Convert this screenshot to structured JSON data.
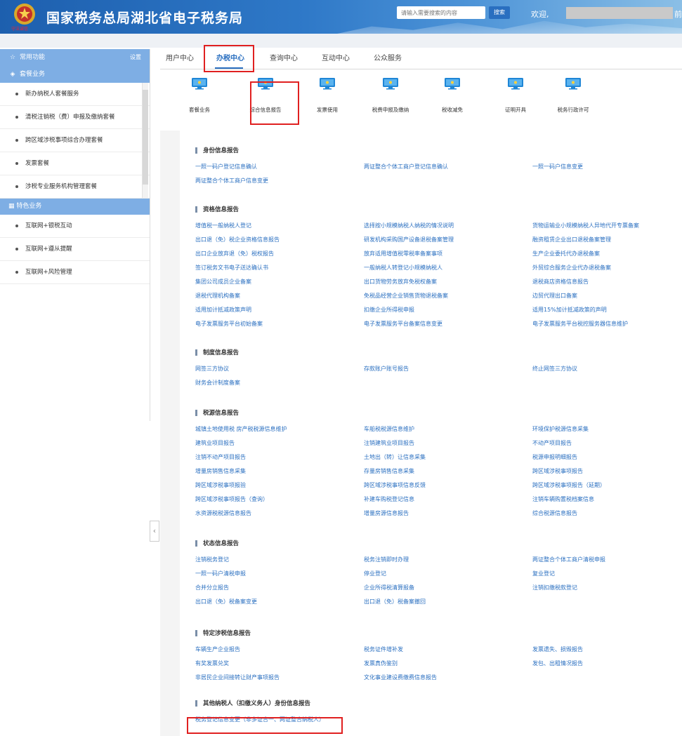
{
  "header": {
    "logo_sub": "守法诚信",
    "title": "国家税务总局湖北省电子税务局",
    "search_placeholder": "请输入需要搜索的内容",
    "search_label": "搜索",
    "welcome": "欢迎,",
    "welcome_tail": "前",
    "logo_color": "#e02020"
  },
  "sidebar": {
    "common": "常用功能",
    "settings": "设置",
    "package": "套餐业务",
    "package_items": [
      "新办纳税人套餐服务",
      "清税注销税（费）申报及缴纳套餐",
      "跨区域涉税事项综合办理套餐",
      "发票套餐",
      "涉税专业服务机构管理套餐"
    ],
    "special": "特色业务",
    "special_items": [
      "互联网+银税互动",
      "互联网+遵从提醒",
      "互联网+风险管理"
    ]
  },
  "tabs": [
    "用户中心",
    "办税中心",
    "查询中心",
    "互动中心",
    "公众服务"
  ],
  "active_tab": "办税中心",
  "icons": [
    "套餐业务",
    "综合信息报告",
    "发票使用",
    "税费申报及缴纳",
    "税收减免",
    "证明开具",
    "税务行政许可"
  ],
  "sections": [
    {
      "title": "身份信息报告",
      "links": [
        [
          "一照一码户登记信息确认",
          "两证整合个体工商户登记信息确认",
          "一照一码户信息变更"
        ],
        [
          "两证整合个体工商户信息变更",
          "",
          ""
        ]
      ]
    },
    {
      "title": "资格信息报告",
      "links": [
        [
          "增值税一般纳税人登记",
          "选择按小规模纳税人纳税的情况说明",
          "货物运输业小规模纳税人异地代开专票备案"
        ],
        [
          "出口退（免）税企业资格信息报告",
          "研发机构采购国产设备退税备案管理",
          "融资租赁企业出口退税备案管理"
        ],
        [
          "出口企业放弃退（免）税权报告",
          "放弃适用增值税零税率备案事项",
          "生产企业委托代办退税备案"
        ],
        [
          "签订税务文书电子送达确认书",
          "一般纳税人转登记小规模纳税人",
          "外贸综合服务企业代办退税备案"
        ],
        [
          "集团公司成员企业备案",
          "出口货物劳务放弃免税权备案",
          "退税商店资格信息报告"
        ],
        [
          "退税代理机构备案",
          "免税品经营企业销售货物退税备案",
          "边贸代理出口备案"
        ],
        [
          "适用加计抵减政策声明",
          "扣缴企业所得税申报",
          "适用15%加计抵减政策的声明"
        ],
        [
          "电子发票服务平台初始备案",
          "电子发票服务平台备案信息变更",
          "电子发票服务平台税控服务器信息维护"
        ]
      ]
    },
    {
      "title": "制度信息报告",
      "links": [
        [
          "网签三方协议",
          "存款账户账号报告",
          "终止网签三方协议"
        ],
        [
          "财务会计制度备案",
          "",
          ""
        ]
      ]
    },
    {
      "title": "税源信息报告",
      "links": [
        [
          "城镇土地使用税 房产税税源信息维护",
          "车船税税源信息维护",
          "环境保护税源信息采集"
        ],
        [
          "建筑业项目报告",
          "注销建筑业项目报告",
          "不动产项目报告"
        ],
        [
          "注销不动产项目报告",
          "土地出（转）让信息采集",
          "税源申报明细报告"
        ],
        [
          "增量房销售信息采集",
          "存量房销售信息采集",
          "跨区域涉税事项报告"
        ],
        [
          "跨区域涉税事项报验",
          "跨区域涉税事项信息反馈",
          "跨区域涉税事项报告（延期）"
        ],
        [
          "跨区域涉税事项报告（查询）",
          "补建车购税登记信息",
          "注销车辆购置税档案信息"
        ],
        [
          "水资源税税源信息报告",
          "增量房源信息报告",
          "综合税源信息报告"
        ]
      ]
    },
    {
      "title": "状态信息报告",
      "links": [
        [
          "注销税务登记",
          "税务注销即时办理",
          "两证整合个体工商户清税申报"
        ],
        [
          "一照一码户清税申报",
          "停业登记",
          "复业登记"
        ],
        [
          "合并分立报告",
          "企业所得税清算报备",
          "注销扣缴税款登记"
        ],
        [
          "出口退（免）税备案变更",
          "出口退（免）税备案撤回",
          ""
        ]
      ]
    },
    {
      "title": "特定涉税信息报告",
      "links": [
        [
          "车辆生产企业报告",
          "税务证件增补发",
          "发票遗失、损毁报告"
        ],
        [
          "有奖发票兑奖",
          "发票真伪鉴别",
          "发包、出租情况报告"
        ],
        [
          "非居民企业间接转让财产事项报告",
          "文化事业建设费缴费信息报告",
          ""
        ]
      ]
    },
    {
      "title": "其他纳税人（扣缴义务人）身份信息报告",
      "links": [
        [
          "税务登记信息变更（非多证合一、两证整合纳税人）",
          "",
          ""
        ]
      ]
    }
  ]
}
